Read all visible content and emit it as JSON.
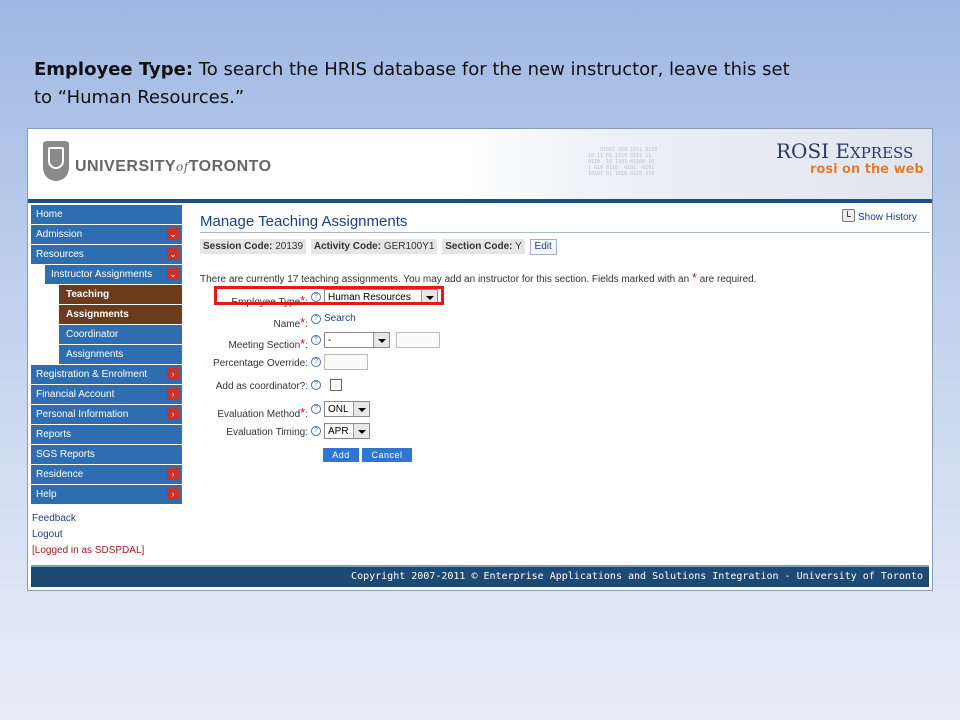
{
  "caption": {
    "bold": "Employee Type:",
    "text": " To search the HRIS database for the new instructor, leave this set to “Human Resources.”"
  },
  "header": {
    "university_main": "UNIVERSITY",
    "university_of": "of",
    "university_city": "TORONTO",
    "rosi_r": "ROSI E",
    "rosi_small": "XPRESS",
    "rosi_tagline": "rosi on the web"
  },
  "sidebar": {
    "items": [
      {
        "label": "Home",
        "arrow": ""
      },
      {
        "label": "Admission",
        "arrow": "⌄"
      },
      {
        "label": "Resources",
        "arrow": "⌄"
      },
      {
        "label": "Instructor Assignments",
        "arrow": "⌄"
      },
      {
        "label": "Teaching",
        "arrow": ""
      },
      {
        "label": "Assignments",
        "arrow": ""
      },
      {
        "label": "Coordinator",
        "arrow": ""
      },
      {
        "label": "Assignments",
        "arrow": ""
      },
      {
        "label": "Registration & Enrolment",
        "arrow": "›"
      },
      {
        "label": "Financial Account",
        "arrow": "›"
      },
      {
        "label": "Personal Information",
        "arrow": "›"
      },
      {
        "label": "Reports",
        "arrow": ""
      },
      {
        "label": "SGS Reports",
        "arrow": ""
      },
      {
        "label": "Residence",
        "arrow": "›"
      },
      {
        "label": "Help",
        "arrow": "›"
      }
    ],
    "links": {
      "feedback": "Feedback",
      "logout": "Logout",
      "logged_in": "[Logged in as SDSPDAL]"
    }
  },
  "main": {
    "title": "Manage Teaching Assignments",
    "show_history": "Show History",
    "codes": {
      "session_label": "Session Code:",
      "session_value": "20139",
      "activity_label": "Activity Code:",
      "activity_value": "GER100Y1",
      "section_label": "Section Code:",
      "section_value": "Y",
      "edit": "Edit"
    },
    "intro": "There are currently 17 teaching assignments. You may add an instructor for this section. Fields marked with an",
    "intro_star": "*",
    "intro_end": "are required.",
    "help_glyph": "?",
    "required_star": "*",
    "fields": {
      "employee_type_label": "Employee Type",
      "employee_type_value": "Human Resources",
      "name_label": "Name",
      "name_search": "Search",
      "meeting_section_label": "Meeting Section",
      "meeting_section_value": "-",
      "percentage_override_label": "Percentage Override:",
      "add_coordinator_label": "Add as coordinator?:",
      "evaluation_method_label": "Evaluation Method",
      "evaluation_method_value": "ONL",
      "evaluation_timing_label": "Evaluation Timing:",
      "evaluation_timing_value": "APR"
    },
    "buttons": {
      "add": "Add",
      "cancel": "Cancel"
    }
  },
  "footer": {
    "text": "Copyright 2007-2011 © Enterprise Applications and Solutions Integration - University of Toronto"
  },
  "colors": {
    "nav_blue": "#2e6db0",
    "nav_active": "#6b3b1b",
    "highlight_red": "#e01b1b",
    "footer": "#1d4a73"
  }
}
